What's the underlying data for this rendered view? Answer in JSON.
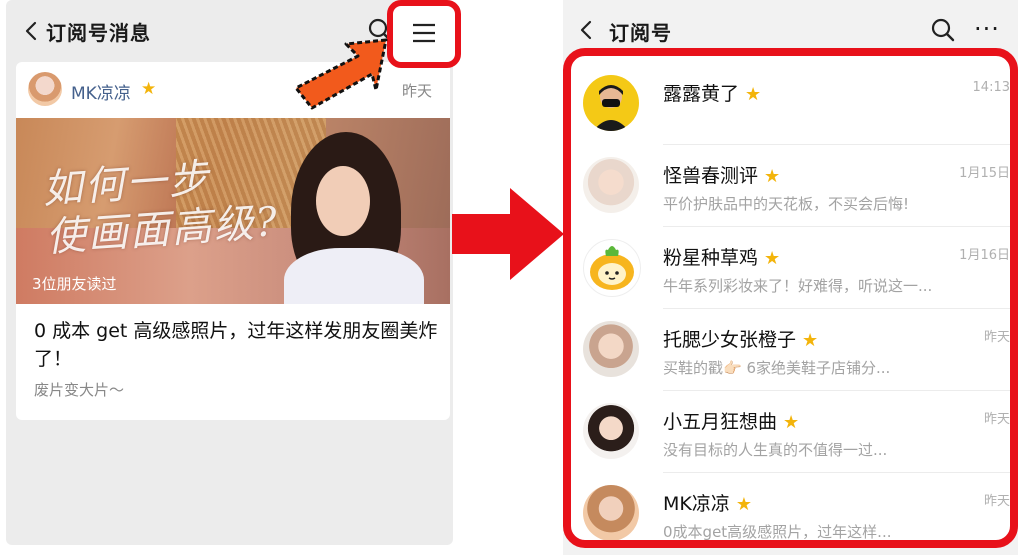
{
  "left_screen": {
    "header": {
      "title": "订阅号消息"
    },
    "card": {
      "account_name": "MK凉凉",
      "time": "昨天",
      "cover_title_line1": "如何一步",
      "cover_title_line2": "使画面高级?",
      "readers": "3位朋友读过",
      "headline": "0 成本 get 高级感照片，过年这样发朋友圈美炸了！",
      "description": "废片变大片～"
    }
  },
  "right_screen": {
    "header": {
      "title": "订阅号",
      "more": "···"
    },
    "subscriptions": [
      {
        "name": "露露黄了",
        "time": "14:13",
        "message": ""
      },
      {
        "name": "怪兽春测评",
        "time": "1月15日",
        "message": "平价护肤品中的天花板，不买会后悔!"
      },
      {
        "name": "粉星种草鸡",
        "time": "1月16日",
        "message": "牛年系列彩妆来了！好难得，听说这一..."
      },
      {
        "name": "托腮少女张橙子",
        "time": "昨天",
        "message": "买鞋的戳👉🏻 6家绝美鞋子店铺分..."
      },
      {
        "name": "小五月狂想曲",
        "time": "昨天",
        "message": "没有目标的人生真的不值得一过..."
      },
      {
        "name": "MK凉凉",
        "time": "昨天",
        "message": "0成本get高级感照片，过年这样..."
      }
    ]
  },
  "colors": {
    "highlight": "#e8111a",
    "star": "#f3b40b",
    "account_link": "#44608c"
  },
  "icons": [
    "back-arrow-icon",
    "search-icon",
    "menu-icon",
    "more-icon",
    "star-icon",
    "pointer-arrow-icon",
    "big-right-arrow-icon"
  ]
}
